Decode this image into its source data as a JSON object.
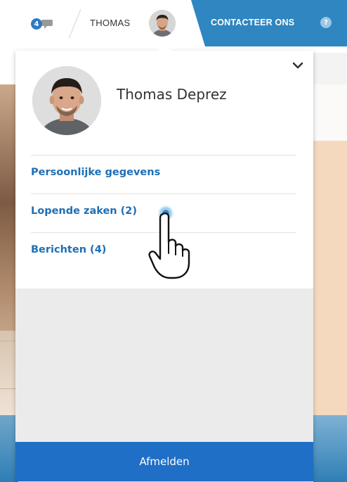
{
  "header": {
    "notification_count": "4",
    "notification_icon": "chat-bubble-icon",
    "username": "THOMAS",
    "contact_label": "CONTACTEER ONS",
    "help_symbol": "?"
  },
  "dropdown": {
    "full_name": "Thomas Deprez",
    "collapse_icon": "chevron-down-icon",
    "menu": {
      "personal": "Persoonlijke gegevens",
      "cases": "Lopende zaken (2)",
      "messages": "Berichten (4)"
    },
    "logout_label": "Afmelden"
  },
  "colors": {
    "link": "#1f6fb4",
    "brand_blue": "#2f86c0",
    "logout_bg": "#1f6fc6",
    "badge": "#2e7bc3"
  }
}
